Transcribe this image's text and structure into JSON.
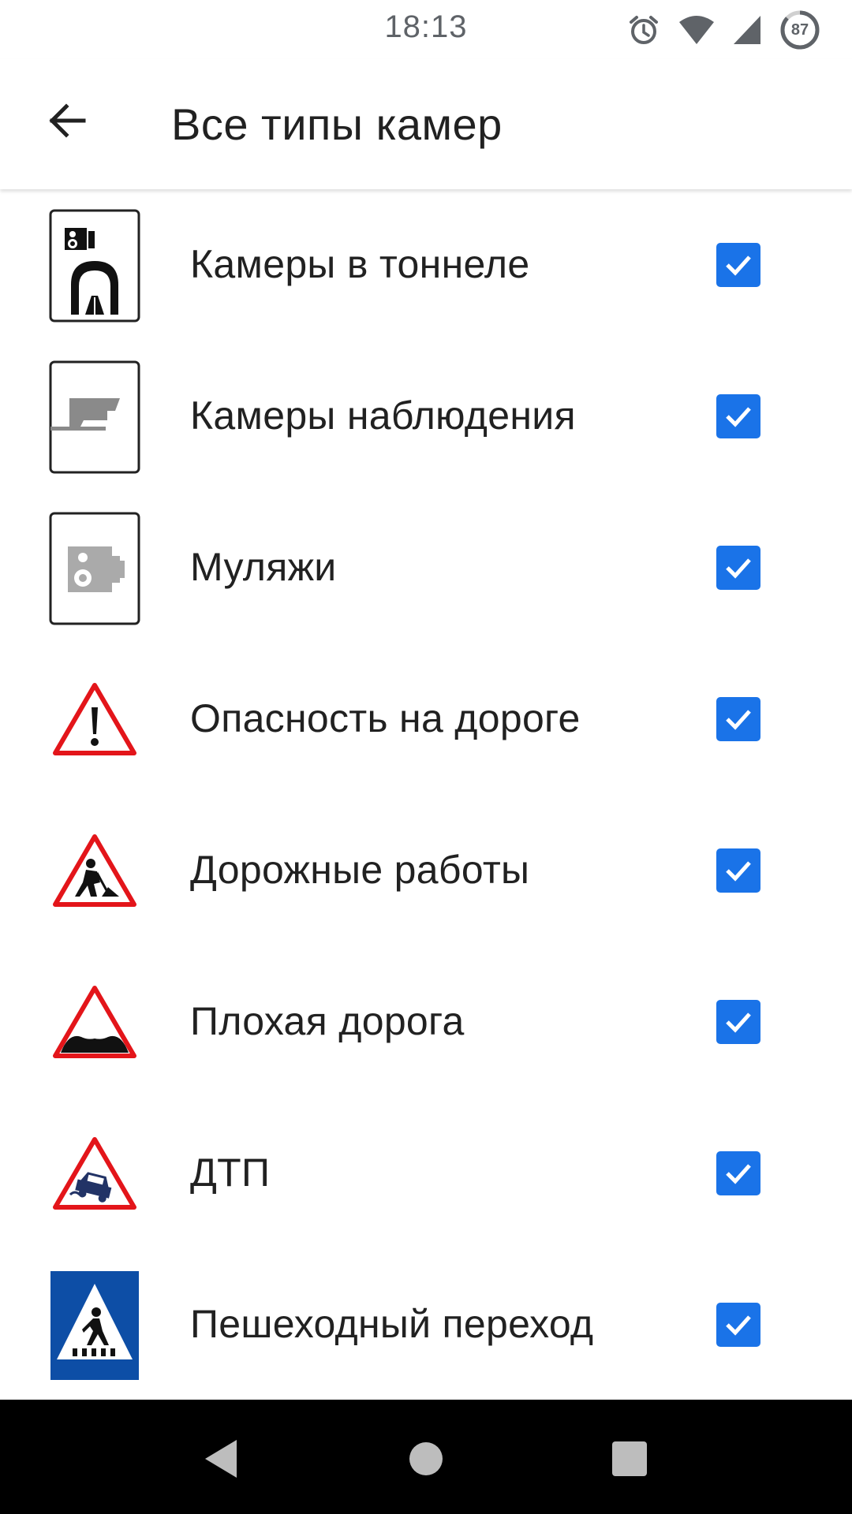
{
  "status_bar": {
    "time": "18:13",
    "battery_level": "87",
    "icons": [
      "alarm-icon",
      "wifi-icon",
      "signal-icon",
      "battery-icon"
    ]
  },
  "app_bar": {
    "back_icon": "arrow-back-icon",
    "title": "Все типы камер"
  },
  "colors": {
    "checkbox_accent": "#1a73e8",
    "warning_red": "#e3151a",
    "pedestrian_blue": "#0d4ea6"
  },
  "camera_types": [
    {
      "label": "Камеры в тоннеле",
      "icon": "tunnel-camera-icon",
      "checked": true
    },
    {
      "label": "Камеры наблюдения",
      "icon": "surveillance-camera-icon",
      "checked": true
    },
    {
      "label": "Муляжи",
      "icon": "dummy-camera-icon",
      "checked": true
    },
    {
      "label": "Опасность на дороге",
      "icon": "road-danger-sign-icon",
      "checked": true
    },
    {
      "label": "Дорожные работы",
      "icon": "road-works-sign-icon",
      "checked": true
    },
    {
      "label": "Плохая дорога",
      "icon": "bad-road-sign-icon",
      "checked": true
    },
    {
      "label": "ДТП",
      "icon": "car-accident-sign-icon",
      "checked": true
    },
    {
      "label": "Пешеходный переход",
      "icon": "pedestrian-crossing-sign-icon",
      "checked": true
    }
  ],
  "nav_bar": {
    "buttons": [
      "nav-back-icon",
      "nav-home-icon",
      "nav-recents-icon"
    ]
  }
}
